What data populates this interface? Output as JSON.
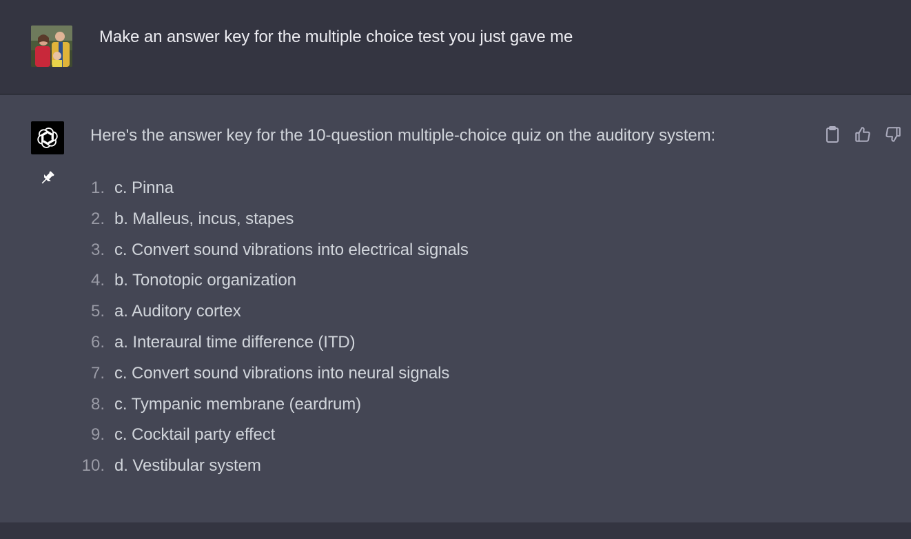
{
  "user": {
    "message": "Make an answer key for the multiple choice test you just gave me"
  },
  "assistant": {
    "intro": "Here's the answer key for the 10-question multiple-choice quiz on the auditory system:",
    "answers": [
      {
        "num": "1.",
        "text": "c. Pinna"
      },
      {
        "num": "2.",
        "text": "b. Malleus, incus, stapes"
      },
      {
        "num": "3.",
        "text": "c. Convert sound vibrations into electrical signals"
      },
      {
        "num": "4.",
        "text": "b. Tonotopic organization"
      },
      {
        "num": "5.",
        "text": "a. Auditory cortex"
      },
      {
        "num": "6.",
        "text": "a. Interaural time difference (ITD)"
      },
      {
        "num": "7.",
        "text": "c. Convert sound vibrations into neural signals"
      },
      {
        "num": "8.",
        "text": "c. Tympanic membrane (eardrum)"
      },
      {
        "num": "9.",
        "text": "c. Cocktail party effect"
      },
      {
        "num": "10.",
        "text": "d. Vestibular system"
      }
    ],
    "actions": [
      {
        "icon": "clipboard-icon"
      },
      {
        "icon": "thumbs-up-icon"
      },
      {
        "icon": "thumbs-down-icon"
      }
    ]
  },
  "colors": {
    "user_bg": "#343541",
    "assistant_bg": "#444654",
    "text": "#d1d5db",
    "muted": "#9a9ba6"
  }
}
